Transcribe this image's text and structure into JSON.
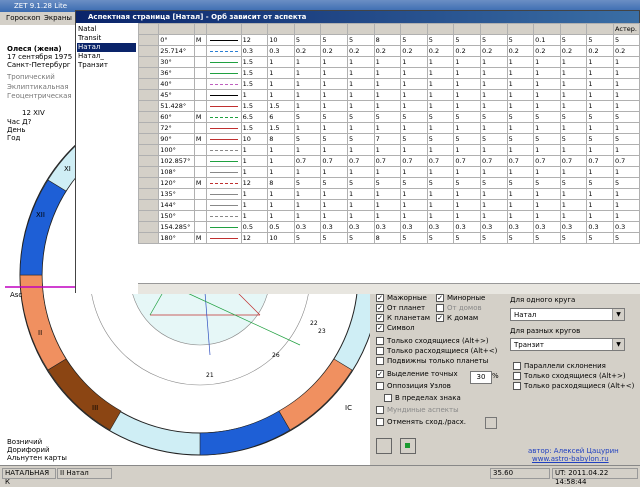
{
  "main_window": {
    "title": "ZET 9.1.28 Lite"
  },
  "menu": [
    "Гороскоп",
    "Экраны"
  ],
  "info": {
    "name": "Олеся (жена)",
    "date": "17 сентября 1975",
    "place": "Санкт-Петербург",
    "lines": [
      "Тропический",
      "Эклиптикальная",
      "Геоцентрическая"
    ],
    "ruler": "12 XIV",
    "hour": "Час Д?",
    "day": "День",
    "year": "Год"
  },
  "bottom_left": [
    "Возничий",
    "Дорифорий",
    "Альнутен карты"
  ],
  "ov": {
    "title": "Аспектная страница [Натал] - Орб зависит от аспекта",
    "list": [
      "Natal",
      "Transit",
      "Натал",
      "Натал_",
      "Транзит"
    ],
    "selected": 2,
    "columns": [
      "",
      "",
      "",
      "",
      "",
      "",
      "",
      "",
      "",
      "",
      "",
      "",
      "",
      "",
      "",
      "",
      "Астер."
    ],
    "rows": [
      [
        "0°",
        "M",
        "12",
        "10",
        "5",
        "5",
        "5",
        "8",
        "5",
        "5",
        "5",
        "5",
        "5",
        "0.1",
        "5",
        "5",
        "5"
      ],
      [
        "25.714°",
        "",
        "0.3",
        "0.3",
        "0.2",
        "0.2",
        "0.2",
        "0.2",
        "0.2",
        "0.2",
        "0.2",
        "0.2",
        "0.2",
        "0.2",
        "0.2",
        "0.2",
        "0.2"
      ],
      [
        "30°",
        "",
        "1.5",
        "1",
        "1",
        "1",
        "1",
        "1",
        "1",
        "1",
        "1",
        "1",
        "1",
        "1",
        "1",
        "1",
        "1"
      ],
      [
        "36°",
        "",
        "1.5",
        "1",
        "1",
        "1",
        "1",
        "1",
        "1",
        "1",
        "1",
        "1",
        "1",
        "1",
        "1",
        "1",
        "1"
      ],
      [
        "40°",
        "",
        "1.5",
        "1",
        "1",
        "1",
        "1",
        "1",
        "1",
        "1",
        "1",
        "1",
        "1",
        "1",
        "1",
        "1",
        "1"
      ],
      [
        "45°",
        "",
        "1",
        "1",
        "1",
        "1",
        "1",
        "1",
        "1",
        "1",
        "1",
        "1",
        "1",
        "1",
        "1",
        "1",
        "1"
      ],
      [
        "51.428°",
        "",
        "1.5",
        "1.5",
        "1",
        "1",
        "1",
        "1",
        "1",
        "1",
        "1",
        "1",
        "1",
        "1",
        "1",
        "1",
        "1"
      ],
      [
        "60°",
        "M",
        "6.5",
        "6",
        "5",
        "5",
        "5",
        "5",
        "5",
        "5",
        "5",
        "5",
        "5",
        "5",
        "5",
        "5",
        "5"
      ],
      [
        "72°",
        "",
        "1.5",
        "1.5",
        "1",
        "1",
        "1",
        "1",
        "1",
        "1",
        "1",
        "1",
        "1",
        "1",
        "1",
        "1",
        "1"
      ],
      [
        "90°",
        "M",
        "10",
        "8",
        "5",
        "5",
        "5",
        "7",
        "5",
        "5",
        "5",
        "5",
        "5",
        "5",
        "5",
        "5",
        "5"
      ],
      [
        "100°",
        "",
        "1",
        "1",
        "1",
        "1",
        "1",
        "1",
        "1",
        "1",
        "1",
        "1",
        "1",
        "1",
        "1",
        "1",
        "1"
      ],
      [
        "102.857°",
        "",
        "1",
        "1",
        "0.7",
        "0.7",
        "0.7",
        "0.7",
        "0.7",
        "0.7",
        "0.7",
        "0.7",
        "0.7",
        "0.7",
        "0.7",
        "0.7",
        "0.7"
      ],
      [
        "108°",
        "",
        "1",
        "1",
        "1",
        "1",
        "1",
        "1",
        "1",
        "1",
        "1",
        "1",
        "1",
        "1",
        "1",
        "1",
        "1"
      ],
      [
        "120°",
        "M",
        "12",
        "8",
        "5",
        "5",
        "5",
        "5",
        "5",
        "5",
        "5",
        "5",
        "5",
        "5",
        "5",
        "5",
        "5"
      ],
      [
        "135°",
        "",
        "1",
        "1",
        "1",
        "1",
        "1",
        "1",
        "1",
        "1",
        "1",
        "1",
        "1",
        "1",
        "1",
        "1",
        "1"
      ],
      [
        "144°",
        "",
        "1",
        "1",
        "1",
        "1",
        "1",
        "1",
        "1",
        "1",
        "1",
        "1",
        "1",
        "1",
        "1",
        "1",
        "1"
      ],
      [
        "150°",
        "",
        "1",
        "1",
        "1",
        "1",
        "1",
        "1",
        "1",
        "1",
        "1",
        "1",
        "1",
        "1",
        "1",
        "1",
        "1"
      ],
      [
        "154.285°",
        "",
        "0.5",
        "0.5",
        "0.3",
        "0.3",
        "0.3",
        "0.3",
        "0.3",
        "0.3",
        "0.3",
        "0.3",
        "0.3",
        "0.3",
        "0.3",
        "0.3",
        "0.3"
      ],
      [
        "180°",
        "M",
        "12",
        "10",
        "5",
        "5",
        "5",
        "8",
        "5",
        "5",
        "5",
        "5",
        "5",
        "5",
        "5",
        "5",
        "5"
      ]
    ]
  },
  "options": {
    "checkboxes": [
      {
        "label": "Мажорные",
        "checked": true
      },
      {
        "label": "Минорные",
        "checked": true
      },
      {
        "label": "От планет",
        "checked": true
      },
      {
        "label": "От домов",
        "checked": false
      },
      {
        "label": "К планетам",
        "checked": true
      },
      {
        "label": "К домам",
        "checked": true
      },
      {
        "label": "Символ",
        "checked": true
      },
      {
        "label": "Только сходящиеся (Alt+>)",
        "checked": false
      },
      {
        "label": "Только расходящиеся (Alt+<)",
        "checked": false
      },
      {
        "label": "Подвижны только планеты",
        "checked": false
      },
      {
        "label": "Выделение точных",
        "checked": true
      },
      {
        "label": "Оппозиция Узлов",
        "checked": false
      },
      {
        "label": "В пределах знака",
        "checked": false
      },
      {
        "label": "Мундиные аспекты",
        "checked": false
      },
      {
        "label": "Отменять сход./расх.",
        "checked": false
      }
    ],
    "exact_value": "30",
    "exact_unit": "%",
    "single_circle_label": "Для одного круга",
    "single_circle_value": "Натал",
    "multi_circle_label": "Для разных кругов",
    "multi_circle_value": "Транзит",
    "right_checks": [
      "Параллели склонения",
      "Только сходящиеся (Alt+>)",
      "Только расходящиеся (Alt+<)"
    ],
    "author": "автор: Алексей Цацурин",
    "site": "www.astro-babylon.ru"
  },
  "status": {
    "cell1": "НАТАЛЬНАЯ К",
    "cell2": "II Натал",
    "value": "35.60",
    "time": "UT: 2011.04.22 14:58:44"
  },
  "chart_labels": {
    "asc": "Asc",
    "houses": [
      "XII",
      "XI",
      "II",
      "III",
      "IC"
    ],
    "planets": [
      "21",
      "22",
      "23",
      "26"
    ]
  },
  "colors": {
    "accent": "#0a246a",
    "line_red": "#c03030",
    "line_green": "#20a040",
    "line_blue": "#3050c0"
  }
}
